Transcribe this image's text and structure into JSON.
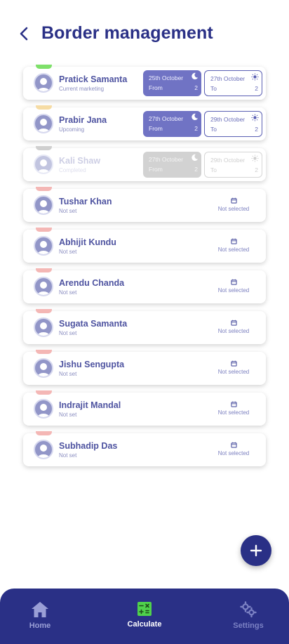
{
  "header": {
    "title": "Border management"
  },
  "icons": {
    "back": "chevron-left-icon",
    "fab": "plus-icon",
    "moon": "moon-icon",
    "sun": "sun-icon",
    "calendar": "calendar-icon",
    "avatar": "user-avatar-icon"
  },
  "colors": {
    "primary": "#2a3086",
    "accent_fill": "#7073c4",
    "calc_icon": "#4fd14c"
  },
  "members": [
    {
      "name": "Pratick Samanta",
      "status": "Current marketing",
      "tab": "green",
      "from": {
        "date": "25th October",
        "label": "From",
        "count": "2"
      },
      "to": {
        "date": "27th October",
        "label": "To",
        "count": "2"
      }
    },
    {
      "name": "Prabir Jana",
      "status": "Upcoming",
      "tab": "amber",
      "from": {
        "date": "27th October",
        "label": "From",
        "count": "2"
      },
      "to": {
        "date": "29th October",
        "label": "To",
        "count": "2"
      }
    },
    {
      "name": "Kali Shaw",
      "status": "Completed",
      "tab": "grey",
      "from": {
        "date": "27th October",
        "label": "From",
        "count": "2"
      },
      "to": {
        "date": "29th October",
        "label": "To",
        "count": "2"
      }
    },
    {
      "name": "Tushar Khan",
      "status": "Not set",
      "tab": "pink",
      "date_text": "Not selected"
    },
    {
      "name": "Abhijit Kundu",
      "status": "Not set",
      "tab": "pink",
      "date_text": "Not selected"
    },
    {
      "name": "Arendu Chanda",
      "status": "Not set",
      "tab": "pink",
      "date_text": "Not selected"
    },
    {
      "name": "Sugata Samanta",
      "status": "Not set",
      "tab": "pink",
      "date_text": "Not selected"
    },
    {
      "name": "Jishu Sengupta",
      "status": "Not set",
      "tab": "pink",
      "date_text": "Not selected"
    },
    {
      "name": "Indrajit Mandal",
      "status": "Not set",
      "tab": "pink",
      "date_text": "Not selected"
    },
    {
      "name": "Subhadip Das",
      "status": "Not set",
      "tab": "pink",
      "date_text": "Not selected"
    }
  ],
  "nav": {
    "home": {
      "label": "Home",
      "icon": "home-icon"
    },
    "calculate": {
      "label": "Calculate",
      "icon": "calculator-icon"
    },
    "settings": {
      "label": "Settings",
      "icon": "gears-icon"
    }
  }
}
